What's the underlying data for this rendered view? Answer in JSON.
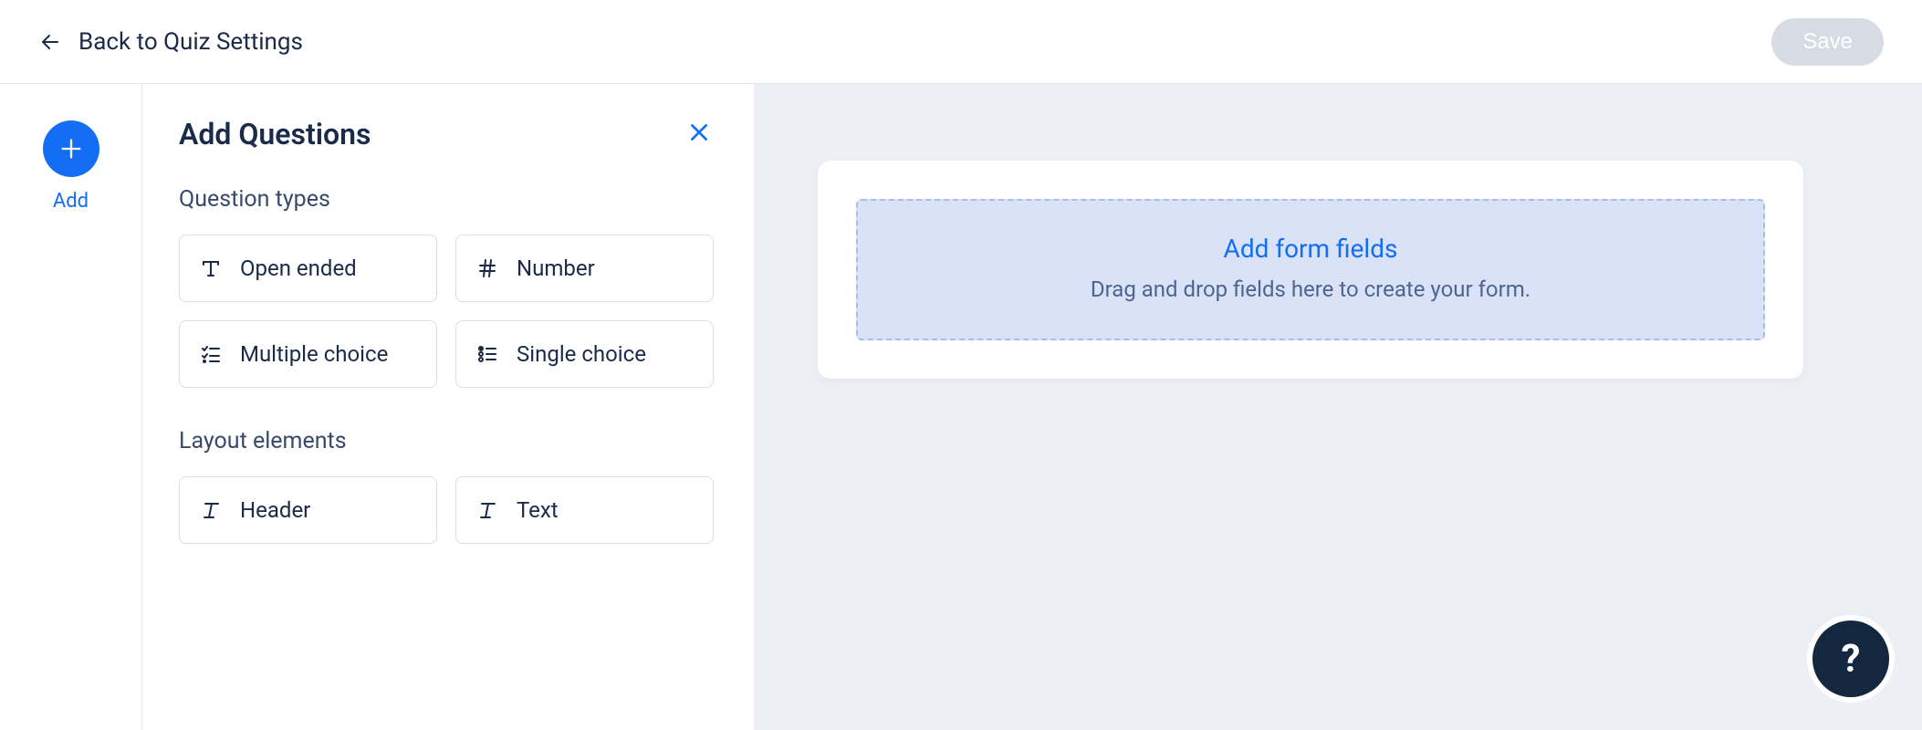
{
  "topbar": {
    "back_label": "Back to Quiz Settings",
    "save_label": "Save"
  },
  "rail": {
    "add_label": "Add"
  },
  "panel": {
    "title": "Add Questions",
    "sections": {
      "question_types": {
        "title": "Question types",
        "items": [
          {
            "icon": "text-t-icon",
            "label": "Open ended"
          },
          {
            "icon": "hash-icon",
            "label": "Number"
          },
          {
            "icon": "checklist-icon",
            "label": "Multiple choice"
          },
          {
            "icon": "radiolist-icon",
            "label": "Single choice"
          }
        ]
      },
      "layout_elements": {
        "title": "Layout elements",
        "items": [
          {
            "icon": "italic-t-icon",
            "label": "Header"
          },
          {
            "icon": "italic-t-icon",
            "label": "Text"
          }
        ]
      }
    }
  },
  "canvas": {
    "dropzone_title": "Add form fields",
    "dropzone_sub": "Drag and drop fields here to create your form."
  },
  "help": {
    "glyph": "?"
  }
}
